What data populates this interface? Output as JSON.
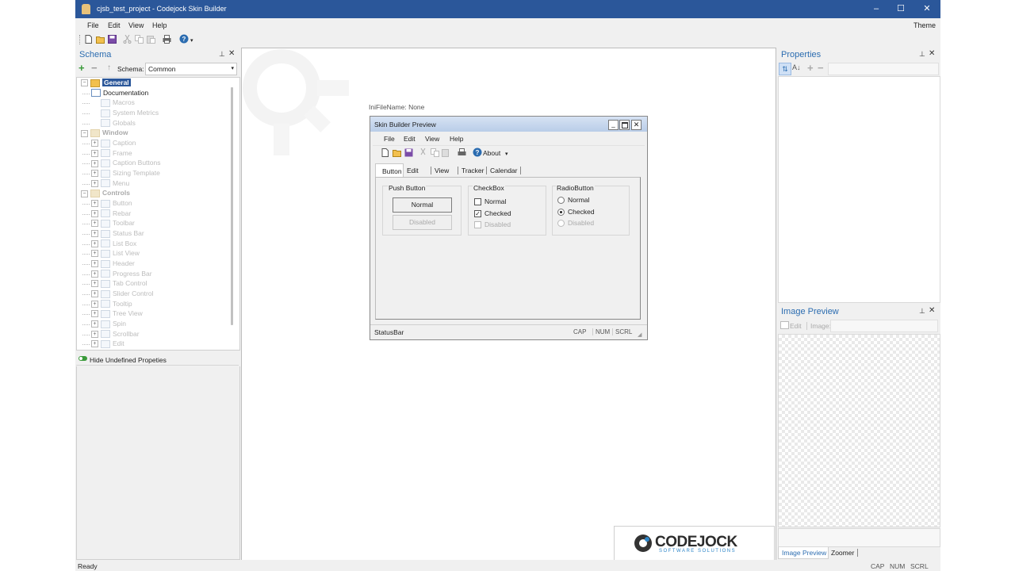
{
  "window": {
    "title": "cjsb_test_project - Codejock Skin Builder",
    "controls": [
      "–",
      "☐",
      "✕"
    ]
  },
  "menubar": {
    "items": [
      "File",
      "Edit",
      "View",
      "Help"
    ],
    "theme": "Theme"
  },
  "toolbar": {
    "icons": [
      "new-icon",
      "open-icon",
      "save-icon",
      "cut-icon",
      "copy-icon",
      "paste-icon",
      "print-icon",
      "help-icon"
    ]
  },
  "schema_panel": {
    "title": "Schema",
    "schema_label": "Schema:",
    "schema_value": "Common",
    "tree": [
      {
        "label": "General",
        "level": 0,
        "selected": true
      },
      {
        "label": "Documentation",
        "level": 1,
        "active": true
      },
      {
        "label": "Macros",
        "level": 1
      },
      {
        "label": "System Metrics",
        "level": 1
      },
      {
        "label": "Globals",
        "level": 1
      },
      {
        "label": "Window",
        "level": 0
      },
      {
        "label": "Caption",
        "level": 1
      },
      {
        "label": "Frame",
        "level": 1
      },
      {
        "label": "Caption Buttons",
        "level": 1
      },
      {
        "label": "Sizing Template",
        "level": 1
      },
      {
        "label": "Menu",
        "level": 1
      },
      {
        "label": "Controls",
        "level": 0
      },
      {
        "label": "Button",
        "level": 1
      },
      {
        "label": "Rebar",
        "level": 1
      },
      {
        "label": "Toolbar",
        "level": 1
      },
      {
        "label": "Status Bar",
        "level": 1
      },
      {
        "label": "List Box",
        "level": 1
      },
      {
        "label": "List View",
        "level": 1
      },
      {
        "label": "Header",
        "level": 1
      },
      {
        "label": "Progress Bar",
        "level": 1
      },
      {
        "label": "Tab Control",
        "level": 1
      },
      {
        "label": "Slider Control",
        "level": 1
      },
      {
        "label": "Tooltip",
        "level": 1
      },
      {
        "label": "Tree View",
        "level": 1
      },
      {
        "label": "Spin",
        "level": 1
      },
      {
        "label": "Scrollbar",
        "level": 1
      },
      {
        "label": "Edit",
        "level": 1
      }
    ],
    "hide_undefined": "Hide Undefined Propeties"
  },
  "document": {
    "ini_file": "IniFileName: None"
  },
  "preview": {
    "title": "Skin Builder Preview",
    "menu": [
      "File",
      "Edit",
      "View",
      "Help"
    ],
    "about": "About",
    "tabs": [
      "Button",
      "Edit",
      "View",
      "Tracker",
      "Calendar"
    ],
    "push_button": {
      "title": "Push Button",
      "normal": "Normal",
      "disabled": "Disabled"
    },
    "checkbox": {
      "title": "CheckBox",
      "normal": "Normal",
      "checked": "Checked",
      "disabled": "Disabled"
    },
    "radiobutton": {
      "title": "RadioButton",
      "normal": "Normal",
      "checked": "Checked",
      "disabled": "Disabled"
    },
    "statusbar": {
      "text": "StatusBar",
      "cap": "CAP",
      "num": "NUM",
      "scrl": "SCRL"
    }
  },
  "logo": {
    "name": "CODEJOCK",
    "tagline": "SOFTWARE SOLUTIONS"
  },
  "properties_panel": {
    "title": "Properties"
  },
  "image_preview_panel": {
    "title": "Image Preview",
    "edit": "Edit",
    "image": "Image:",
    "tabs": [
      "Image Preview",
      "Zoomer"
    ]
  },
  "statusbar": {
    "text": "Ready",
    "cap": "CAP",
    "num": "NUM",
    "scrl": "SCRL"
  },
  "colors": {
    "titlebar": "#2b579a",
    "panel_title": "#2b6cb0",
    "selection": "#2b579a"
  }
}
